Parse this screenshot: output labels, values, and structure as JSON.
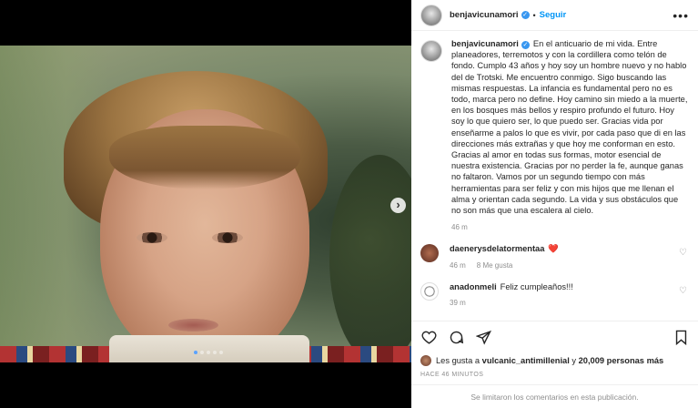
{
  "post": {
    "username": "benjavicunamori",
    "follow_label": "Seguir",
    "separator": "•",
    "more_label": "•••",
    "caption": "En el anticuario de mi vida. Entre planeadores, terremotos y con la cordillera como telón de fondo. Cumplo 43 años y hoy soy un hombre nuevo y no hablo del de Trotski. Me encuentro conmigo. Sigo buscando las mismas respuestas. La infancia es fundamental pero no es todo, marca pero no define. Hoy camino sin miedo a la muerte, en los bosques más bellos y respiro profundo el futuro. Hoy soy lo que quiero ser, lo que puedo ser. Gracias vida por enseñarme a palos lo que es vivir, por cada paso que di en las direcciones más extrañas y que hoy me conforman en esto. Gracias al amor en todas sus formas, motor esencial de nuestra existencia. Gracias por no perder la fe, aunque ganas no faltaron. Vamos por un segundo tiempo con más herramientas para ser feliz y con mis hijos que me llenan el alma y orientan cada segundo. La vida y sus obstáculos que no son más que una escalera al cielo.",
    "caption_time": "46 m"
  },
  "comments": [
    {
      "username": "daenerysdelatormentaa",
      "text": "❤️",
      "time": "46 m",
      "likes": "8 Me gusta"
    },
    {
      "username": "anadonmeli",
      "text": "Feliz cumpleaños!!!",
      "time": "39 m",
      "likes": ""
    }
  ],
  "likes_summary": {
    "prefix": "Les gusta a",
    "user": "vulcanic_antimillenial",
    "conjunction": "y",
    "others": "20,009 personas más"
  },
  "timestamp": "HACE 46 MINUTOS",
  "comments_limited": "Se limitaron los comentarios en esta publicación.",
  "carousel": {
    "slides": 5,
    "active_index": 0
  },
  "icons": [
    "verified-icon",
    "more-icon",
    "heart-icon",
    "comment-icon",
    "share-icon",
    "bookmark-icon",
    "chevron-right-icon"
  ],
  "colors": {
    "link": "#0095f6",
    "verified": "#3897f0",
    "carousel_active": "#5aa2ff"
  }
}
